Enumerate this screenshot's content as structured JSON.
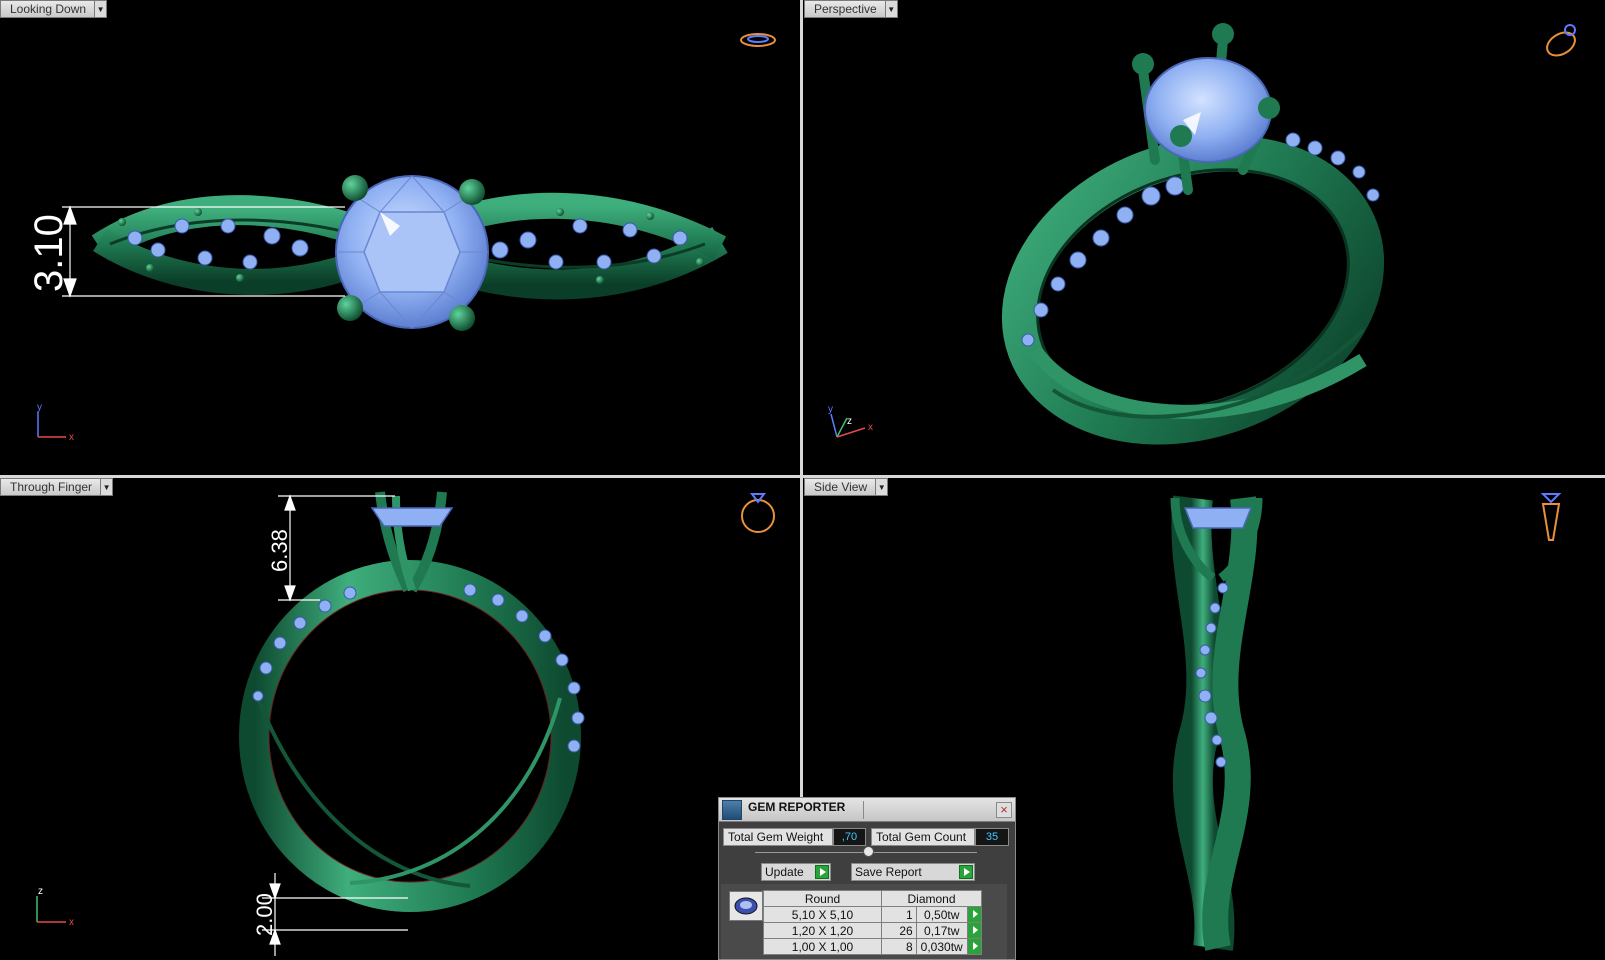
{
  "viewports": {
    "top_left": {
      "label": "Looking Down",
      "axes": [
        "y",
        "x"
      ],
      "dimension": "3.10"
    },
    "top_right": {
      "label": "Perspective",
      "axes": [
        "y",
        "z",
        "x"
      ]
    },
    "bottom_left": {
      "label": "Through Finger",
      "axes": [
        "z",
        "x"
      ],
      "dimension_top": "6.38",
      "dimension_bottom": "2.00"
    },
    "bottom_right": {
      "label": "Side View"
    }
  },
  "gem_reporter": {
    "title": "GEM REPORTER",
    "close_label": "×",
    "total_weight_label": "Total Gem Weight",
    "total_weight_value": ",70",
    "total_count_label": "Total Gem Count",
    "total_count_value": "35",
    "update_label": "Update",
    "save_report_label": "Save Report",
    "table": {
      "headers": [
        "Round",
        "Diamond"
      ],
      "rows": [
        {
          "size": "5,10 X 5,10",
          "count": "1",
          "weight": "0,50tw"
        },
        {
          "size": "1,20 X 1,20",
          "count": "26",
          "weight": "0,17tw"
        },
        {
          "size": "1,00 X 1,00",
          "count": "8",
          "weight": "0,030tw"
        }
      ]
    }
  },
  "colors": {
    "metal": "#1f7a52",
    "gem": "#8fb0f2",
    "background": "#000000",
    "dimension": "#ffffff",
    "navigator_icon": "#e8913a"
  }
}
